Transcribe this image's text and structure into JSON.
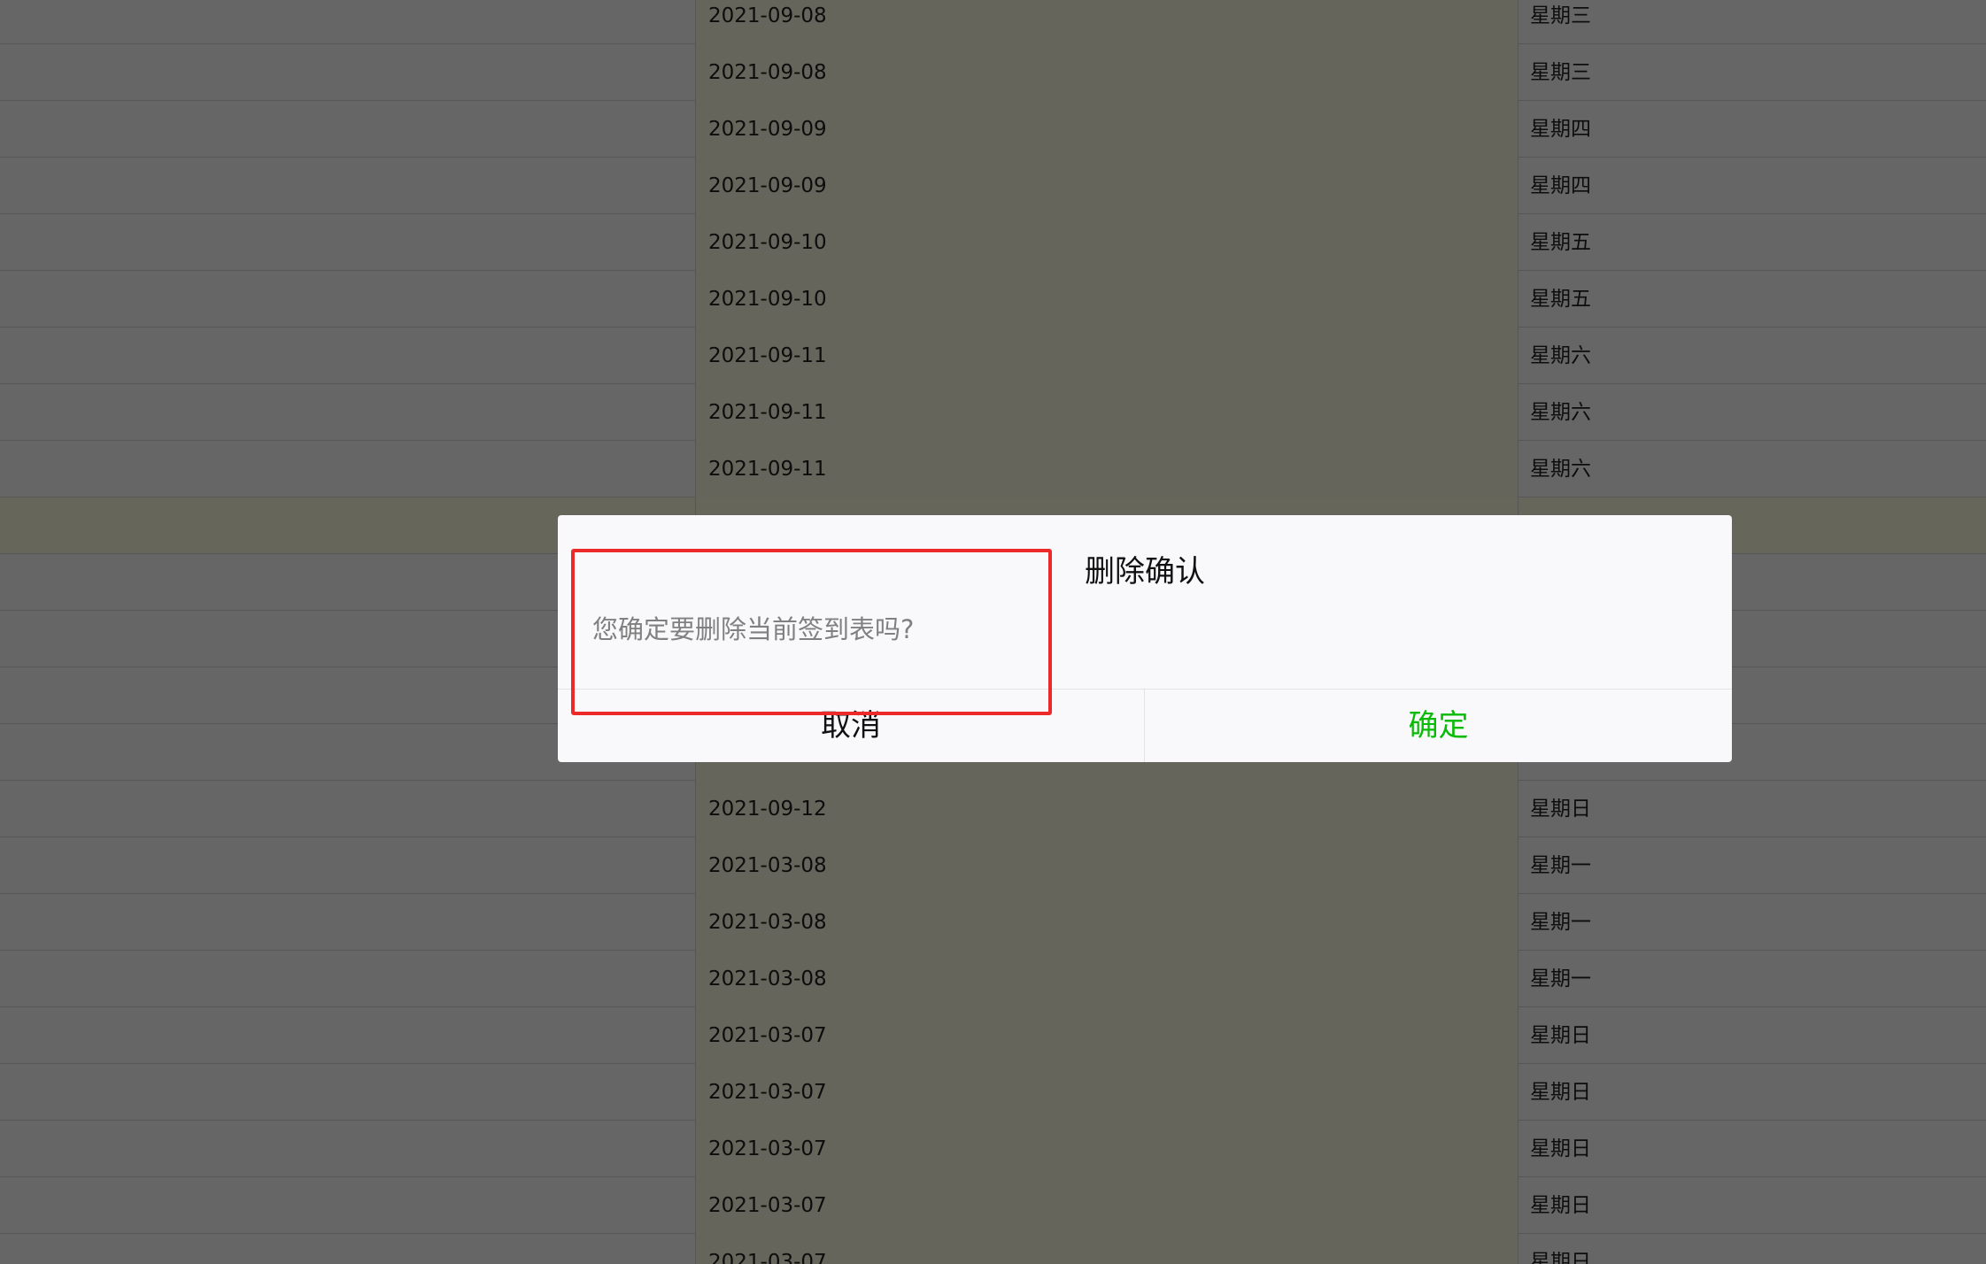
{
  "table": {
    "rows": [
      {
        "date": "2021-09-08",
        "day": "星期三"
      },
      {
        "date": "2021-09-08",
        "day": "星期三"
      },
      {
        "date": "2021-09-09",
        "day": "星期四"
      },
      {
        "date": "2021-09-09",
        "day": "星期四"
      },
      {
        "date": "2021-09-10",
        "day": "星期五"
      },
      {
        "date": "2021-09-10",
        "day": "星期五"
      },
      {
        "date": "2021-09-11",
        "day": "星期六"
      },
      {
        "date": "2021-09-11",
        "day": "星期六"
      },
      {
        "date": "2021-09-11",
        "day": "星期六"
      },
      {
        "date": "",
        "day": "",
        "highlight": true
      },
      {
        "date": "",
        "day": ""
      },
      {
        "date": "",
        "day": ""
      },
      {
        "date": "",
        "day": ""
      },
      {
        "date": "",
        "day": ""
      },
      {
        "date": "2021-09-12",
        "day": "星期日"
      },
      {
        "date": "2021-03-08",
        "day": "星期一"
      },
      {
        "date": "2021-03-08",
        "day": "星期一"
      },
      {
        "date": "2021-03-08",
        "day": "星期一"
      },
      {
        "date": "2021-03-07",
        "day": "星期日"
      },
      {
        "date": "2021-03-07",
        "day": "星期日"
      },
      {
        "date": "2021-03-07",
        "day": "星期日"
      },
      {
        "date": "2021-03-07",
        "day": "星期日"
      },
      {
        "date": "2021-03-07",
        "day": "星期日"
      }
    ]
  },
  "dialog": {
    "title": "删除确认",
    "message": "您确定要删除当前签到表吗?",
    "cancel_label": "取消",
    "confirm_label": "确定"
  },
  "colors": {
    "overlay": "rgba(0,0,0,0.6)",
    "confirm_text": "#09bb07",
    "annotation_border": "#ec2a2a"
  }
}
